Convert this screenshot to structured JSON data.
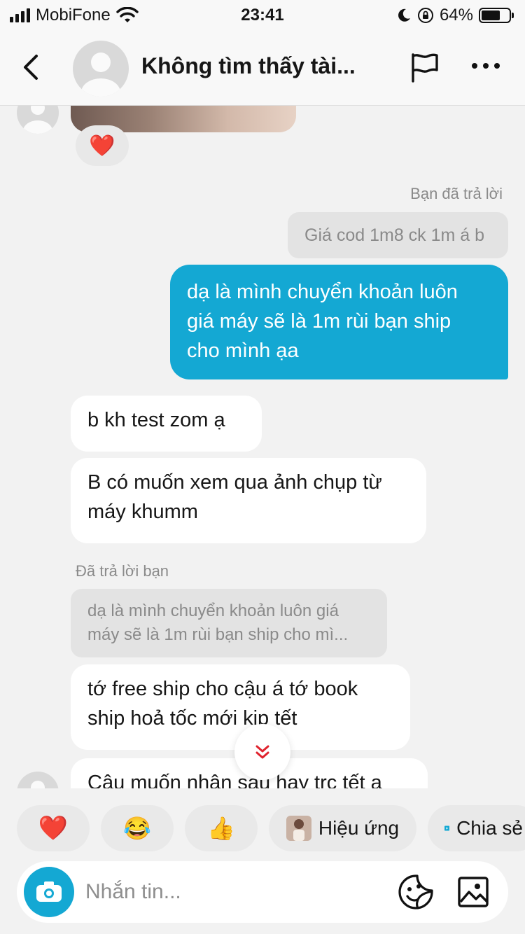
{
  "status_bar": {
    "carrier": "MobiFone",
    "time": "23:41",
    "battery": "64%"
  },
  "header": {
    "title": "Không tìm thấy tài..."
  },
  "messages": {
    "reaction_emoji": "❤️",
    "reply_meta_you": "Bạn đã trả lời",
    "quote_1": "Giá cod 1m8 ck 1m á b",
    "outgoing_1_line1": "dạ là mình chuyển khoản luôn",
    "outgoing_1_line2": "giá máy sẽ là 1m rùi bạn ship",
    "outgoing_1_line3": "cho mình ạa",
    "incoming_1": "b kh test zom ạ",
    "incoming_2_line1": "B có muốn xem qua ảnh chụp từ",
    "incoming_2_line2": "máy khumm",
    "reply_meta_them": "Đã trả lời bạn",
    "quote_2_line1": "dạ là mình chuyển khoản luôn giá",
    "quote_2_line2": "máy sẽ là 1m rùi bạn ship cho mì...",
    "incoming_3_line1": "tớ free ship cho cậu á tớ book",
    "incoming_3_line2": "ship hoả tốc mới kịp tết",
    "incoming_4": "Cậu muốn nhận sau hay trc tết ạ"
  },
  "quick_reactions": [
    {
      "emoji": "❤️",
      "icon": "heart"
    },
    {
      "emoji": "😂",
      "icon": "laughing-face"
    },
    {
      "emoji": "👍",
      "icon": "thumbs-up"
    }
  ],
  "chips": {
    "effects_label": "Hiệu ứng",
    "share_label": "Chia sẻ"
  },
  "composer": {
    "placeholder": "Nhắn tin..."
  },
  "colors": {
    "accent": "#14a8d3",
    "heart": "#e0232e",
    "background": "#f2f2f2",
    "bubble_in": "#ffffff",
    "quote_bg": "#e3e3e3"
  }
}
